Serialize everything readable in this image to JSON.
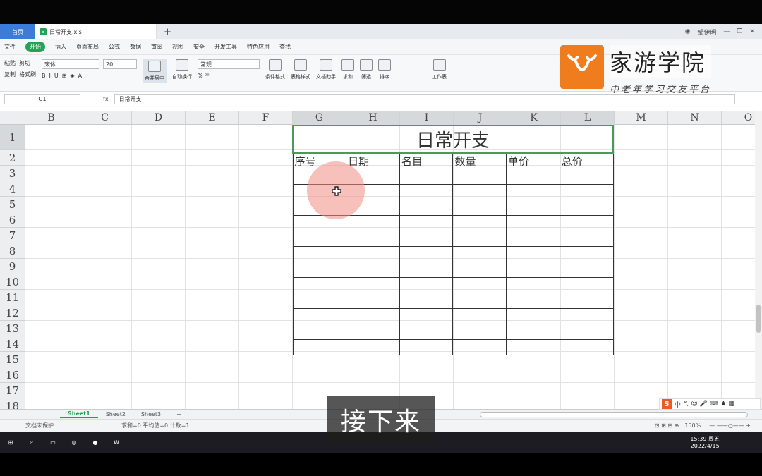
{
  "tabs": {
    "home": "首页",
    "file": "日常开支.xls",
    "user": "邹伊明"
  },
  "menu": [
    "文件",
    "开始",
    "插入",
    "页面布局",
    "公式",
    "数据",
    "审阅",
    "视图",
    "安全",
    "开发工具",
    "特色应用",
    "查找"
  ],
  "toolbar": {
    "cut": "剪切",
    "paste": "粘贴",
    "copy": "复制",
    "format_painter": "格式刷",
    "font": "宋体",
    "font_size": "20",
    "merge_center": "合并居中",
    "wrap": "自动换行",
    "number_format": "常规",
    "cond_format": "条件格式",
    "table_style": "表格样式",
    "doc_helper": "文档助手",
    "sum": "求和",
    "filter": "筛选",
    "sort": "排序",
    "worksheet": "工作表"
  },
  "formula": {
    "cell_ref": "G1",
    "fx": "fx",
    "content": "日常开支"
  },
  "columns": [
    "B",
    "C",
    "D",
    "E",
    "F",
    "G",
    "H",
    "I",
    "J",
    "K",
    "L",
    "M",
    "N",
    "O"
  ],
  "rows": [
    "1",
    "2",
    "3",
    "4",
    "5",
    "6",
    "7",
    "8",
    "9",
    "10",
    "11",
    "12",
    "13",
    "14",
    "15",
    "16",
    "17",
    "18"
  ],
  "sheet": {
    "title": "日常开支",
    "headers": [
      "序号",
      "日期",
      "名目",
      "数量",
      "单价",
      "总价"
    ]
  },
  "sheet_tabs": [
    "Sheet1",
    "Sheet2",
    "Sheet3"
  ],
  "status": {
    "protect": "文档未保护",
    "stats": "求和=0  平均值=0  计数=1",
    "zoom": "150%"
  },
  "clock": {
    "time": "15:39 周五",
    "date": "2022/4/15"
  },
  "watermark": {
    "name": "家游学院",
    "slogan": "中老年学习交友平台"
  },
  "subtitle": "接下来",
  "ime_label": "中"
}
